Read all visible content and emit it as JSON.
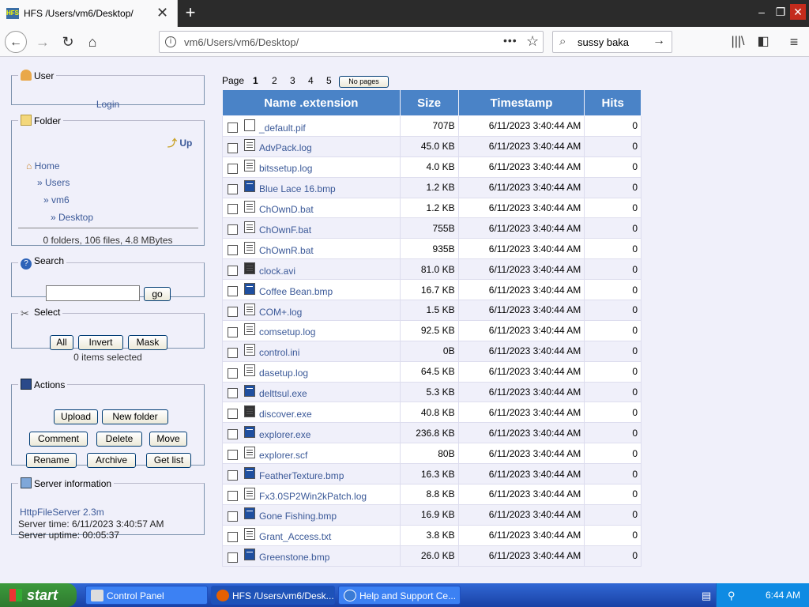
{
  "browser": {
    "tab_title": "HFS /Users/vm6/Desktop/",
    "url": "vm6/Users/vm6/Desktop/",
    "search_value": "sussy baka"
  },
  "user_panel": {
    "title": "User",
    "login": "Login"
  },
  "folder_panel": {
    "title": "Folder",
    "up": "Up",
    "home": "Home",
    "crumbs": [
      "» Users",
      "» vm6",
      "» Desktop"
    ],
    "stats": "0 folders, 106 files, 4.8 MBytes"
  },
  "search_panel": {
    "title": "Search",
    "go": "go"
  },
  "select_panel": {
    "title": "Select",
    "all": "All",
    "invert": "Invert",
    "mask": "Mask",
    "status": "0 items selected"
  },
  "actions_panel": {
    "title": "Actions",
    "upload": "Upload",
    "new_folder": "New folder",
    "comment": "Comment",
    "delete": "Delete",
    "move": "Move",
    "rename": "Rename",
    "archive": "Archive",
    "get_list": "Get list"
  },
  "server_panel": {
    "title": "Server information",
    "link": "HttpFileServer 2.3m",
    "time": "Server time: 6/11/2023 3:40:57 AM",
    "uptime": "Server uptime: 00:05:37"
  },
  "pager": {
    "label": "Page",
    "pages": [
      "1",
      "2",
      "3",
      "4",
      "5"
    ],
    "no_pages": "No pages"
  },
  "table": {
    "headers": {
      "name": "Name .extension",
      "size": "Size",
      "timestamp": "Timestamp",
      "hits": "Hits"
    },
    "rows": [
      {
        "name": "_default.pif",
        "size": "707B",
        "timestamp": "6/11/2023 3:40:44 AM",
        "hits": "0",
        "icon": "blank"
      },
      {
        "name": "AdvPack.log",
        "size": "45.0 KB",
        "timestamp": "6/11/2023 3:40:44 AM",
        "hits": "0",
        "icon": "text"
      },
      {
        "name": "bitssetup.log",
        "size": "4.0 KB",
        "timestamp": "6/11/2023 3:40:44 AM",
        "hits": "0",
        "icon": "text"
      },
      {
        "name": "Blue Lace 16.bmp",
        "size": "1.2 KB",
        "timestamp": "6/11/2023 3:40:44 AM",
        "hits": "0",
        "icon": "img"
      },
      {
        "name": "ChOwnD.bat",
        "size": "1.2 KB",
        "timestamp": "6/11/2023 3:40:44 AM",
        "hits": "0",
        "icon": "text"
      },
      {
        "name": "ChOwnF.bat",
        "size": "755B",
        "timestamp": "6/11/2023 3:40:44 AM",
        "hits": "0",
        "icon": "text"
      },
      {
        "name": "ChOwnR.bat",
        "size": "935B",
        "timestamp": "6/11/2023 3:40:44 AM",
        "hits": "0",
        "icon": "text"
      },
      {
        "name": "clock.avi",
        "size": "81.0 KB",
        "timestamp": "6/11/2023 3:40:44 AM",
        "hits": "0",
        "icon": "exe"
      },
      {
        "name": "Coffee Bean.bmp",
        "size": "16.7 KB",
        "timestamp": "6/11/2023 3:40:44 AM",
        "hits": "0",
        "icon": "img"
      },
      {
        "name": "COM+.log",
        "size": "1.5 KB",
        "timestamp": "6/11/2023 3:40:44 AM",
        "hits": "0",
        "icon": "text"
      },
      {
        "name": "comsetup.log",
        "size": "92.5 KB",
        "timestamp": "6/11/2023 3:40:44 AM",
        "hits": "0",
        "icon": "text"
      },
      {
        "name": "control.ini",
        "size": "0B",
        "timestamp": "6/11/2023 3:40:44 AM",
        "hits": "0",
        "icon": "text"
      },
      {
        "name": "dasetup.log",
        "size": "64.5 KB",
        "timestamp": "6/11/2023 3:40:44 AM",
        "hits": "0",
        "icon": "text"
      },
      {
        "name": "delttsul.exe",
        "size": "5.3 KB",
        "timestamp": "6/11/2023 3:40:44 AM",
        "hits": "0",
        "icon": "img"
      },
      {
        "name": "discover.exe",
        "size": "40.8 KB",
        "timestamp": "6/11/2023 3:40:44 AM",
        "hits": "0",
        "icon": "exe"
      },
      {
        "name": "explorer.exe",
        "size": "236.8 KB",
        "timestamp": "6/11/2023 3:40:44 AM",
        "hits": "0",
        "icon": "img"
      },
      {
        "name": "explorer.scf",
        "size": "80B",
        "timestamp": "6/11/2023 3:40:44 AM",
        "hits": "0",
        "icon": "text"
      },
      {
        "name": "FeatherTexture.bmp",
        "size": "16.3 KB",
        "timestamp": "6/11/2023 3:40:44 AM",
        "hits": "0",
        "icon": "img"
      },
      {
        "name": "Fx3.0SP2Win2kPatch.log",
        "size": "8.8 KB",
        "timestamp": "6/11/2023 3:40:44 AM",
        "hits": "0",
        "icon": "text"
      },
      {
        "name": "Gone Fishing.bmp",
        "size": "16.9 KB",
        "timestamp": "6/11/2023 3:40:44 AM",
        "hits": "0",
        "icon": "img"
      },
      {
        "name": "Grant_Access.txt",
        "size": "3.8 KB",
        "timestamp": "6/11/2023 3:40:44 AM",
        "hits": "0",
        "icon": "text"
      },
      {
        "name": "Greenstone.bmp",
        "size": "26.0 KB",
        "timestamp": "6/11/2023 3:40:44 AM",
        "hits": "0",
        "icon": "img"
      }
    ]
  },
  "taskbar": {
    "start": "start",
    "tasks": [
      "Control Panel",
      "HFS /Users/vm6/Desk...",
      "Help and Support Ce..."
    ],
    "time": "6:44 AM"
  },
  "colors": {
    "header_blue": "#4a83c7",
    "link": "#3b5998",
    "page_bg": "#f0f0fa"
  }
}
